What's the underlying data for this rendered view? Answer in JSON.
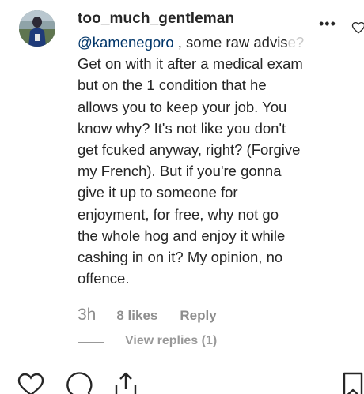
{
  "comment": {
    "username": "too_much_gentleman",
    "mention": "@kamenegoro",
    "text_visible": " , some raw advis",
    "text_faded": "e?",
    "lines": [
      "Get on with it after a medical exam",
      "but on the 1 condition that he",
      "allows you to keep your job. You",
      "know why? It's not like you don't",
      "get fcuked anyway, right? (Forgive",
      "my French). But if you're gonna",
      "give it up to someone for",
      "enjoyment, for free, why not go",
      "the whole hog and enjoy it while",
      "cashing in on it? My opinion, no",
      "offence."
    ],
    "more_icon": "•••",
    "time": "3h",
    "likes": "8 likes",
    "reply_label": "Reply",
    "view_replies": "View replies (1)"
  },
  "icons": {
    "more": "more-icon",
    "like_small": "heart-outline-icon",
    "like": "heart-outline-icon",
    "comment": "comment-bubble-icon",
    "share": "share-icon",
    "save": "bookmark-icon"
  },
  "colors": {
    "text": "#262626",
    "mention": "#003569",
    "meta": "#8e8e8e"
  }
}
